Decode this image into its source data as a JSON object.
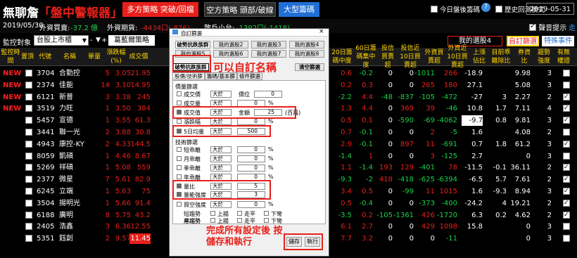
{
  "app": {
    "logo_main": "無聊詹",
    "logo_red": "「盤中警報器」",
    "tabs": [
      {
        "label": "多方策略 突破/回檔",
        "bg": "#e8201b"
      },
      {
        "label": "空方策略 頭部/破線",
        "bg": "#2e2e2e"
      },
      {
        "label": "大型籌碼",
        "bg": "#1f6fd6"
      }
    ],
    "option1": "今日盤後籌碼",
    "option2": "歷史回測模式",
    "date": "2019-05-31"
  },
  "info": {
    "date": "2019/05/30",
    "fx_label": "外資買賣:",
    "fx_val": "-37.2 億",
    "fut_label": "外資期貨:",
    "fut_val": "-4434口(-876)",
    "close_label": "散戶小台:",
    "close_val": "-1392口(-1418)",
    "sound": "聲音提示",
    "close_tab": "走"
  },
  "ctrl": {
    "label": "監控對象",
    "select": "台股上市櫃",
    "btn1": "葛藍爾策略",
    "my_group": "我的選股4",
    "custom": "自訂篩選",
    "special": "特殊事件"
  },
  "headers": [
    "監控時間",
    "置頂",
    "代號",
    "名稱",
    "單量",
    "漲跌幅(%)",
    "成交價",
    "",
    "",
    "",
    "",
    "",
    "20日籌碼中度",
    "60日籌碼集中度",
    "投信買賣超",
    "投信近10日買賣超",
    "外資買賣超",
    "外資近10日買賣超",
    "上漲佔比",
    "目前乖離除比",
    "券資比",
    "趨勢強度",
    "有無權證"
  ],
  "rows": [
    {
      "t": "NEW",
      "code": "3704",
      "name": "合勤控",
      "pct": "5",
      "chg": "3.05",
      "price": "21.95",
      "c1": "0.6",
      "c2": "-0.2",
      "c3": "0",
      "c4": "0",
      "c5": "-1011",
      "c6": "266",
      "c7": "-18.9",
      "c8": "",
      "c9": "9.98",
      "c10": "3",
      "w": false
    },
    {
      "t": "NEW",
      "code": "2374",
      "name": "佳能",
      "pct": "14",
      "chg": "3.10",
      "price": "14.95",
      "c1": "0.2",
      "c2": "0.3",
      "c3": "0",
      "c4": "0",
      "c5": "265",
      "c6": "180",
      "c7": "27.1",
      "c8": "",
      "c9": "5.08",
      "c10": "3",
      "w": false
    },
    {
      "t": "NEW",
      "code": "6121",
      "name": "新普",
      "pct": "3",
      "chg": "3.38",
      "price": "245",
      "c1": "-2.2",
      "c2": "4.4",
      "c3": "-48",
      "c4": "-837",
      "c5": "-105",
      "c6": "-472",
      "c7": "-27",
      "c8": "3",
      "c9": "2.27",
      "c10": "2",
      "w": true
    },
    {
      "t": "NEW",
      "code": "3519",
      "name": "力旺",
      "pct": "1",
      "chg": "3.50",
      "price": "384",
      "c1": "1.3",
      "c2": "4.4",
      "c3": "0",
      "c4": "369",
      "c5": "39",
      "c6": "-46",
      "c7": "10.8",
      "c8": "1.7",
      "c9": "7.11",
      "c10": "4",
      "w": true
    },
    {
      "t": "",
      "code": "5457",
      "name": "宣德",
      "pct": "1",
      "chg": "3.55",
      "price": "61.3",
      "c1": "0.5",
      "c2": "0.1",
      "c3": "0",
      "c4": "-590",
      "c5": "-69",
      "c6": "-4062",
      "c7": "-9.7",
      "c8": "0.8",
      "c9": "9.81",
      "c10": "3",
      "w": true
    },
    {
      "t": "",
      "code": "3441",
      "name": "聯一光",
      "pct": "2",
      "chg": "3.88",
      "price": "30.8",
      "c1": "0.7",
      "c2": "-0.1",
      "c3": "0",
      "c4": "0",
      "c5": "2",
      "c6": "-5",
      "c7": "1.6",
      "c8": "",
      "c9": "4.08",
      "c10": "2",
      "w": false
    },
    {
      "t": "",
      "code": "4943",
      "name": "康控-KY",
      "pct": "2",
      "chg": "4.33",
      "price": "144.5",
      "c1": "2.9",
      "c2": "-0.1",
      "c3": "0",
      "c4": "897",
      "c5": "11",
      "c6": "-691",
      "c7": "0.7",
      "c8": "1.8",
      "c9": "61.2",
      "c10": "3",
      "w": true
    },
    {
      "t": "",
      "code": "8059",
      "name": "凱碩",
      "pct": "1",
      "chg": "4.46",
      "price": "8.67",
      "c1": "-1.4",
      "c2": "1",
      "c3": "0",
      "c4": "0",
      "c5": "3",
      "c6": "-125",
      "c7": "2.7",
      "c8": "",
      "c9": "0",
      "c10": "3",
      "w": false
    },
    {
      "t": "",
      "code": "5269",
      "name": "祥碩",
      "pct": "1",
      "chg": "5.08",
      "price": "559",
      "c1": "1.1",
      "c2": "-1.4",
      "c3": "193",
      "c4": "129",
      "c5": "-401",
      "c6": "78",
      "c7": "-11.5",
      "c8": "-0.1",
      "c9": "36.11",
      "c10": "2",
      "w": true
    },
    {
      "t": "",
      "code": "2377",
      "name": "微星",
      "pct": "7",
      "chg": "5.61",
      "price": "82.9",
      "c1": "-9.3",
      "c2": "-2",
      "c3": "418",
      "c4": "-418",
      "c5": "-625",
      "c6": "-6394",
      "c7": "-6.5",
      "c8": "5.7",
      "c9": "7.61",
      "c10": "2",
      "w": true
    },
    {
      "t": "",
      "code": "6245",
      "name": "立端",
      "pct": "1",
      "chg": "5.63",
      "price": "75",
      "c1": "3.4",
      "c2": "0.5",
      "c3": "0",
      "c4": "-99",
      "c5": "11",
      "c6": "1015",
      "c7": "1.6",
      "c8": "-9.3",
      "c9": "8.94",
      "c10": "3",
      "w": true
    },
    {
      "t": "",
      "code": "3504",
      "name": "揚明光",
      "pct": "1",
      "chg": "5.66",
      "price": "91.4",
      "c1": "0.5",
      "c2": "-0.4",
      "c3": "0",
      "c4": "0",
      "c5": "-373",
      "c6": "-400",
      "c7": "-24.2",
      "c8": "4",
      "c9": "19.21",
      "c10": "2",
      "w": true
    },
    {
      "t": "",
      "code": "6188",
      "name": "廣明",
      "pct": "8",
      "chg": "5.75",
      "price": "43.2",
      "c1": "-3.5",
      "c2": "0.2",
      "c3": "-105",
      "c4": "-1361",
      "c5": "426",
      "c6": "-1720",
      "c7": "6.3",
      "c8": "0.2",
      "c9": "4.62",
      "c10": "2",
      "w": true
    },
    {
      "t": "",
      "code": "2405",
      "name": "浩鑫",
      "pct": "3",
      "chg": "6.36",
      "price": "12.55",
      "c1": "6.1",
      "c2": "2.7",
      "c3": "0",
      "c4": "0",
      "c5": "429",
      "c6": "1098",
      "c7": "15.8",
      "c8": "",
      "c9": "0",
      "c10": "3",
      "w": false
    },
    {
      "t": "",
      "code": "5351",
      "name": "鈺創",
      "pct": "2",
      "chg": "9.57",
      "price": "11.45",
      "c1": "7.7",
      "c2": "3.2",
      "c3": "0",
      "c4": "0",
      "c5": "0",
      "c6": "-11",
      "c7": "",
      "c8": "",
      "c9": "0",
      "c10": "3",
      "w": false
    }
  ],
  "dialog": {
    "title": "自訂篩選",
    "groups": [
      "破勢抗跌族群",
      "我的選股2",
      "我的選股3",
      "我的選股4",
      "我的選股5",
      "我的選股6",
      "我的選股7",
      "我的選股8"
    ],
    "name_label": "破勢抗跌族群",
    "name_input_hint": "可以自訂名稱",
    "subtab1": "股價/技術篩選",
    "subtab2": "籌碼/基本篩選",
    "subtab3": "條件篩選",
    "clear": "清空篩選",
    "sec1": "價量篩選",
    "f1": "成交價",
    "f1_op": "大於",
    "f1_extra": "價位",
    "f1_v": "0",
    "f2": "成交量",
    "f2_op": "大於",
    "f2_v": "0",
    "f3": "成交值",
    "f3_op": "大於",
    "f3_extra": "金額",
    "f3_v": "25",
    "f3_unit": "(百萬)",
    "f4": "漲跌幅",
    "f4_op": "大於",
    "f4_v": "0",
    "pct": "%",
    "f5": "5日均量",
    "f5_op": "大於",
    "f5_v": "500",
    "sec2": "技術篩選",
    "g1": "短乖離",
    "g2": "月乖離",
    "g3": "季乖離",
    "g4": "年乖離",
    "g_op": "大於",
    "g_v": "0",
    "g5": "量比",
    "g6": "量能強度",
    "g6_op": "大於",
    "g6_v": "3",
    "g5_v": "5",
    "g7": "買空強度",
    "g7_op": "大於",
    "g7_v": "0",
    "t1": "短趨勢",
    "t2": "月趨勢",
    "t3": "季趨勢",
    "up": "上揚",
    "flat": "走平",
    "down": "下彎",
    "hint": "完成所有設定後 按儲存和執行",
    "save": "儲存",
    "run": "執行"
  },
  "colors": {
    "red": "#e8201b",
    "green": "#1dd14a",
    "yellow": "#ffd400",
    "annot": "#e8201b"
  }
}
